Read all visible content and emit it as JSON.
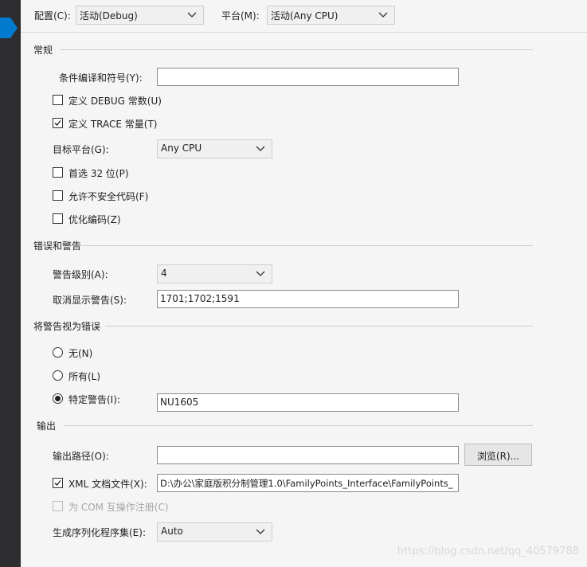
{
  "topbar": {
    "config_label": "配置(C):",
    "config_value": "活动(Debug)",
    "platform_label": "平台(M):",
    "platform_value": "活动(Any CPU)"
  },
  "general": {
    "title": "常规",
    "conditional_symbols_label": "条件编译和符号(Y):",
    "conditional_symbols_value": "",
    "define_debug_label": "定义 DEBUG 常数(U)",
    "define_debug_checked": false,
    "define_trace_label": "定义 TRACE 常量(T)",
    "define_trace_checked": true,
    "platform_target_label": "目标平台(G):",
    "platform_target_value": "Any CPU",
    "prefer32_label": "首选 32 位(P)",
    "prefer32_checked": false,
    "unsafe_label": "允许不安全代码(F)",
    "unsafe_checked": false,
    "optimize_label": "优化编码(Z)",
    "optimize_checked": false
  },
  "errors": {
    "title": "错误和警告",
    "warning_level_label": "警告级别(A):",
    "warning_level_value": "4",
    "suppress_label": "取消显示警告(S):",
    "suppress_value": "1701;1702;1591"
  },
  "treat_warnings": {
    "title": "将警告视为错误",
    "none_label": "无(N)",
    "all_label": "所有(L)",
    "specific_label": "特定警告(I):",
    "specific_value": "NU1605",
    "selected": "specific"
  },
  "output": {
    "title": "输出",
    "path_label": "输出路径(O):",
    "path_value": "",
    "browse_label": "浏览(R)...",
    "xml_doc_label": "XML 文档文件(X):",
    "xml_doc_checked": true,
    "xml_doc_value": "D:\\办公\\家庭版积分制管理1.0\\FamilyPoints_Interface\\FamilyPoints_",
    "com_interop_label": "为 COM 互操作注册(C)",
    "com_interop_checked": false,
    "com_interop_enabled": false,
    "serialization_label": "生成序列化程序集(E):",
    "serialization_value": "Auto"
  },
  "watermark": "https://blog.csdn.net/qq_40579788"
}
